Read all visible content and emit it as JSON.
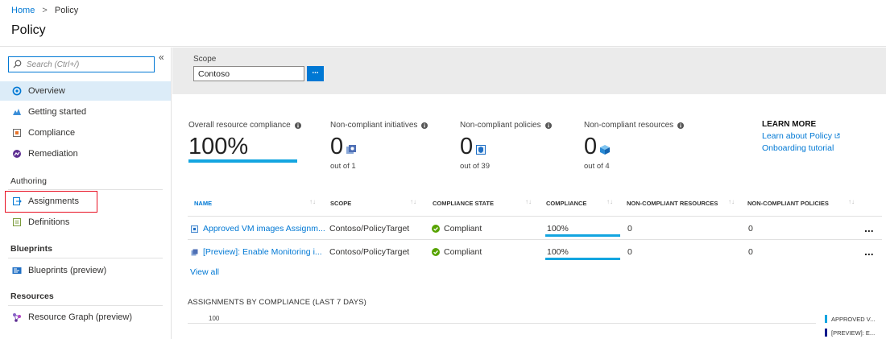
{
  "breadcrumb": {
    "home": "Home",
    "separator": ">",
    "current": "Policy"
  },
  "page_title": "Policy",
  "sidebar": {
    "collapse_glyph": "«",
    "search_placeholder": "Search (Ctrl+/)",
    "items": [
      {
        "label": "Overview",
        "icon": "overview-icon",
        "selected": true
      },
      {
        "label": "Getting started",
        "icon": "getting-started-icon"
      },
      {
        "label": "Compliance",
        "icon": "compliance-icon"
      },
      {
        "label": "Remediation",
        "icon": "remediation-icon"
      }
    ],
    "groups": [
      {
        "label": "Authoring",
        "items": [
          {
            "label": "Assignments",
            "icon": "assignments-icon"
          },
          {
            "label": "Definitions",
            "icon": "definitions-icon"
          }
        ]
      },
      {
        "label": "Blueprints",
        "items": [
          {
            "label": "Blueprints (preview)",
            "icon": "blueprints-icon"
          }
        ]
      },
      {
        "label": "Resources",
        "items": [
          {
            "label": "Resource Graph (preview)",
            "icon": "resource-graph-icon"
          }
        ]
      }
    ]
  },
  "scope": {
    "label": "Scope",
    "value": "Contoso",
    "button_label": "..."
  },
  "stats": {
    "overall": {
      "label": "Overall resource compliance",
      "value": "100%",
      "percent": 100
    },
    "initiatives": {
      "label": "Non-compliant initiatives",
      "value": "0",
      "out_of": "out of 1"
    },
    "policies": {
      "label": "Non-compliant policies",
      "value": "0",
      "out_of": "out of 39"
    },
    "resources": {
      "label": "Non-compliant resources",
      "value": "0",
      "out_of": "out of 4"
    }
  },
  "learn_more": {
    "title": "LEARN MORE",
    "links": [
      "Learn about Policy",
      "Onboarding tutorial"
    ]
  },
  "table": {
    "columns": [
      "NAME",
      "SCOPE",
      "COMPLIANCE STATE",
      "COMPLIANCE",
      "NON-COMPLIANT RESOURCES",
      "NON-COMPLIANT POLICIES"
    ],
    "rows": [
      {
        "name": "Approved VM images Assignm...",
        "scope": "Contoso/PolicyTarget",
        "state": "Compliant",
        "compliance": "100%",
        "compliance_percent": 100,
        "nc_resources": "0",
        "nc_policies": "0",
        "more": "..."
      },
      {
        "name": "[Preview]: Enable Monitoring i...",
        "scope": "Contoso/PolicyTarget",
        "state": "Compliant",
        "compliance": "100%",
        "compliance_percent": 100,
        "nc_resources": "0",
        "nc_policies": "0",
        "more": "..."
      }
    ],
    "view_all": "View all"
  },
  "chart_data": {
    "type": "line",
    "title": "ASSIGNMENTS BY COMPLIANCE (LAST 7 DAYS)",
    "y_tick_labels": [
      "100"
    ],
    "series": [
      {
        "name": "APPROVED V...",
        "color": "#13a5e0"
      },
      {
        "name": "[PREVIEW]: E...",
        "color": "#0a1a8c"
      }
    ]
  },
  "colors": {
    "accent": "#0078d4",
    "bar": "#13a5e0",
    "selected": "#dcecf8",
    "highlight": "#e81123",
    "ok": "#57a300"
  }
}
